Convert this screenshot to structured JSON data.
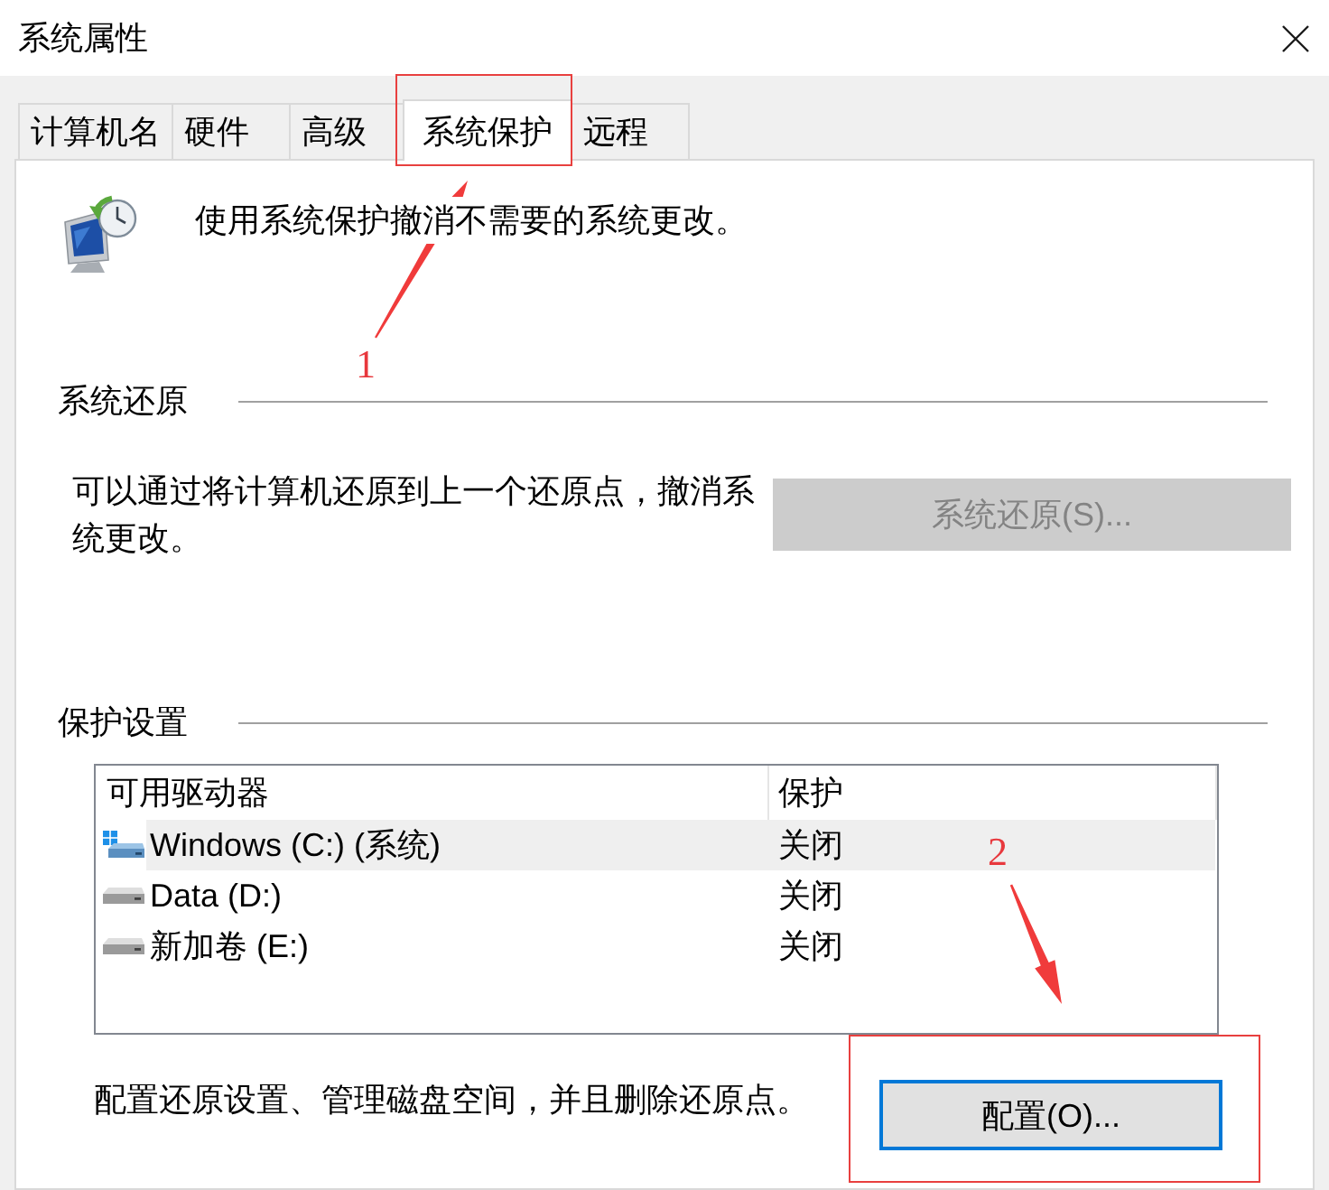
{
  "window": {
    "title": "系统属性"
  },
  "tabs": [
    {
      "label": "计算机名",
      "selected": false
    },
    {
      "label": "硬件",
      "selected": false
    },
    {
      "label": "高级",
      "selected": false
    },
    {
      "label": "系统保护",
      "selected": true
    },
    {
      "label": "远程",
      "selected": false
    }
  ],
  "intro": {
    "text": "使用系统保护撤消不需要的系统更改。"
  },
  "restore_section": {
    "heading": "系统还原",
    "description": "可以通过将计算机还原到上一个还原点，撤消系统更改。",
    "button": {
      "label": "系统还原(S)...",
      "disabled": true,
      "focused": false
    }
  },
  "protection_section": {
    "heading": "保护设置",
    "table": {
      "columns": [
        "可用驱动器",
        "保护"
      ],
      "rows": [
        {
          "kind": "system",
          "drive": "Windows (C:) (系统)",
          "protection": "关闭",
          "selected": true
        },
        {
          "kind": "disk",
          "drive": "Data (D:)",
          "protection": "关闭",
          "selected": false
        },
        {
          "kind": "disk",
          "drive": "新加卷 (E:)",
          "protection": "关闭",
          "selected": false
        }
      ]
    },
    "description": "配置还原设置、管理磁盘空间，并且删除还原点。",
    "button": {
      "label": "配置(O)...",
      "disabled": false,
      "focused": true
    }
  },
  "annotations": [
    {
      "number": "1"
    },
    {
      "number": "2"
    }
  ]
}
